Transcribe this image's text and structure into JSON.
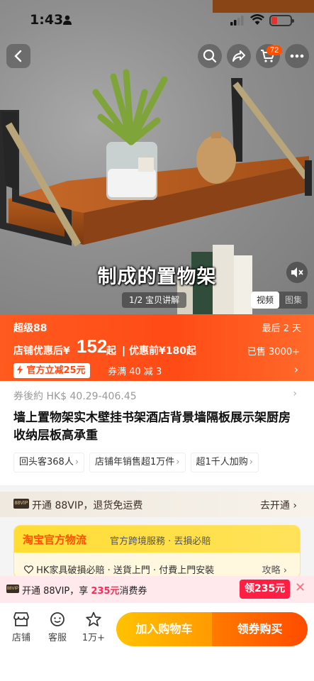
{
  "status_bar": {
    "time": "1:43"
  },
  "hero": {
    "cart_count": "72",
    "caption": "制成的置物架",
    "page_indicator": "1/2 宝贝讲解",
    "mode_tabs": [
      "视频",
      "图集"
    ]
  },
  "price_banner": {
    "label": "超级88",
    "days_left": "最后 2 天",
    "price_prefix": "店铺优惠后",
    "price_currency": "¥",
    "price": "152",
    "price_suffix": "起",
    "price_before": "| 优惠前¥180起",
    "sold": "已售 3000+",
    "official_discount": "官方立减25元",
    "coupon": "券满 40 减 3"
  },
  "product": {
    "approx_price": "券後約 HK$ 40.29-406.45",
    "title": "墙上置物架实木壁挂书架酒店背景墙隔板展示架厨房收纳层板高承重",
    "tags": [
      "回头客368人",
      "店铺年销售超1万件",
      "超1千人加购"
    ]
  },
  "vip": {
    "logo": "88VIP",
    "text": "开通 88VIP，退货免运费",
    "action": "去开通"
  },
  "logistics": {
    "brand": "淘宝官方物流",
    "subtitle": "官方跨境服務 · 丟損必賠",
    "line": "HK家具破損必賠 · 送貨上門 · 付費上門安裝",
    "guide": "攻略"
  },
  "promo": {
    "logo": "88VIP",
    "text_prefix": "开通 88VIP，享 ",
    "amount": "235元",
    "text_suffix": "消费券",
    "button": "领235元"
  },
  "bottom_bar": {
    "store": "店铺",
    "service": "客服",
    "fav": "1万+",
    "add_cart": "加入购物车",
    "buy": "领券购买"
  },
  "colors": {
    "accent": "#ff5000",
    "banner": "#ff4b16",
    "cart_cta": "#ffb300",
    "buy_cta": "#ff5a00"
  }
}
